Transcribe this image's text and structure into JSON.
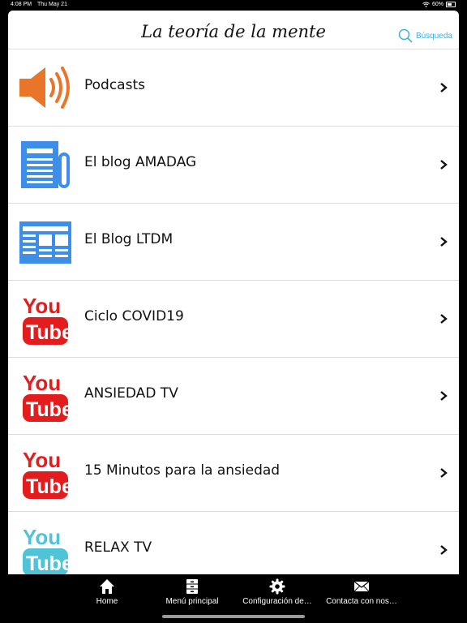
{
  "status_bar": {
    "time": "4:08 PM",
    "date": "Thu May 21",
    "battery": "60%"
  },
  "header": {
    "title": "La  teoría de la mente",
    "search_label": "Búsqueda"
  },
  "menu": [
    {
      "label": "Podcasts",
      "icon": "speaker-icon"
    },
    {
      "label": "El blog AMADAG",
      "icon": "newspaper-icon"
    },
    {
      "label": "El Blog LTDM",
      "icon": "news-layout-icon"
    },
    {
      "label": "Ciclo COVID19",
      "icon": "youtube-icon"
    },
    {
      "label": "ANSIEDAD TV",
      "icon": "youtube-icon"
    },
    {
      "label": "15 Minutos para la ansiedad",
      "icon": "youtube-icon"
    },
    {
      "label": "RELAX TV",
      "icon": "youtube-teal-icon"
    }
  ],
  "youtube": {
    "you": "You",
    "tube": "Tube"
  },
  "tabs": [
    {
      "label": "Home",
      "icon": "home-icon"
    },
    {
      "label": "Menú principal",
      "icon": "cabinet-icon"
    },
    {
      "label": "Configuración de…",
      "icon": "gear-icon"
    },
    {
      "label": "Contacta con nos…",
      "icon": "envelope-icon"
    }
  ],
  "colors": {
    "accent": "#45aee0",
    "speaker": "#e9752b",
    "blue_icon": "#3d8ee8",
    "youtube_red": "#e31d1d",
    "youtube_teal": "#4fc4d6"
  }
}
